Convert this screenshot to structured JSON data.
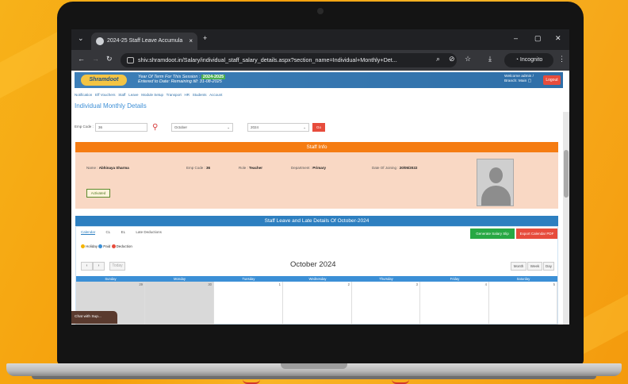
{
  "browser": {
    "tab_title": "2024-25 Staff Leave Accumula",
    "tab_close": "×",
    "new_tab": "+",
    "url": "shiv.shramdoot.in/Salary/individual_staff_salary_details.aspx?section_name=Individual+Monthly+Det...",
    "profile": "Incognito",
    "window_controls": [
      "–",
      "▢",
      "✕"
    ]
  },
  "header": {
    "logo": "Shramdoot",
    "session_line1": "Year Of Term For This Session :",
    "session_badge": "2024-2025",
    "session_line2": "Entered to Date: Remaining till: 31-08-2025",
    "user_line1": "Welcome admin /",
    "user_line2": "Branch: Main ▢",
    "logout": "Logout"
  },
  "menu": [
    "Notification",
    "Eff Vouchers",
    "Staff",
    "Leave",
    "Module Setup",
    "Transport",
    "HR",
    "Students",
    "Account"
  ],
  "page_title": "Individual Monthly Details",
  "filters": {
    "emp_code_label": "Emp Code :",
    "emp_code_value": "36",
    "month_value": "October",
    "year_value": "2024",
    "go_label": "Go"
  },
  "staff_info": {
    "header": "Staff Info",
    "name_label": "Name :",
    "name_value": "Abhinaya Sharma",
    "empcode_label": "Emp Code :",
    "empcode_value": "36",
    "role_label": "Role :",
    "role_value": "Teacher",
    "dept_label": "Department :",
    "dept_value": "Primary",
    "doj_label": "Date Of Joining :",
    "doj_value": "20/05/2022",
    "status": "Activated"
  },
  "leave": {
    "header": "Staff Leave and Late Details Of October-2024",
    "tabs": [
      "Calendar",
      "CL",
      "EL",
      "Late Deductions"
    ],
    "generate_btn": "Generate Salary Slip",
    "export_btn": "Export Calendar PDF",
    "legend": [
      {
        "label": "Holiday",
        "color": "#f4b400"
      },
      {
        "label": "Paid",
        "color": "#3b8fd6"
      },
      {
        "label": "Deduction",
        "color": "#e74c3c"
      }
    ],
    "prev": "‹",
    "next": "›",
    "today": "Today",
    "month_title": "October 2024",
    "views": [
      "Month",
      "Week",
      "Day"
    ],
    "days": [
      "Sunday",
      "Monday",
      "Tuesday",
      "Wednesday",
      "Thursday",
      "Friday",
      "Saturday"
    ],
    "first_row_dates": [
      "29",
      "30",
      "1",
      "2",
      "3",
      "4",
      "5"
    ]
  },
  "chat_widget": "Chat with Sup...",
  "colors": {
    "header_blue": "#2f6fa8",
    "orange": "#f57c12",
    "peach": "#f9d8c4",
    "green": "#27a844",
    "red": "#e74c3c"
  }
}
